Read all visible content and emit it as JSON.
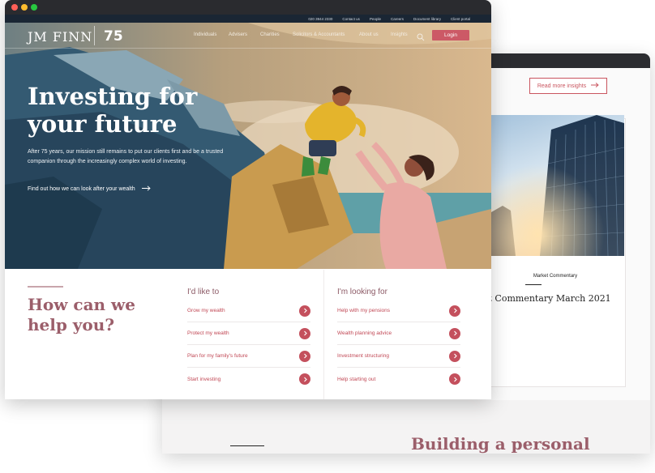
{
  "back_page": {
    "read_more_label": "Read more insights",
    "market_label": "Market Commentary",
    "market_title": "et Commentary March 2021",
    "lower_title": "Building a personal"
  },
  "utility_nav": [
    "020 3944 2330",
    "Contact us",
    "People",
    "Careers",
    "Document library",
    "Client portal"
  ],
  "brand": {
    "logo": "JM FINN",
    "badge": "75"
  },
  "main_nav": {
    "items": [
      "Individuals",
      "Advisers",
      "Charities",
      "Solicitors & Accountants",
      "About us",
      "Insights"
    ],
    "login_label": "Login"
  },
  "hero": {
    "title": "Investing for your future",
    "description": "After 75 years, our mission still remains to put our clients first and be a trusted companion through the increasingly complex world of investing.",
    "cta": "Find out how we can look after your wealth"
  },
  "help": {
    "title": "How can we help you?",
    "col1": {
      "heading": "I'd like to",
      "items": [
        "Grow my wealth",
        "Protect my wealth",
        "Plan for my family's future",
        "Start investing"
      ]
    },
    "col2": {
      "heading": "I'm looking for",
      "items": [
        "Help with my pensions",
        "Wealth planning advice",
        "Investment structuring",
        "Help starting out"
      ]
    }
  },
  "colors": {
    "accent": "#c4505d",
    "heading": "#9b5e6a",
    "chrome": "#2a2b2f",
    "utility_bar": "#1a2634"
  }
}
